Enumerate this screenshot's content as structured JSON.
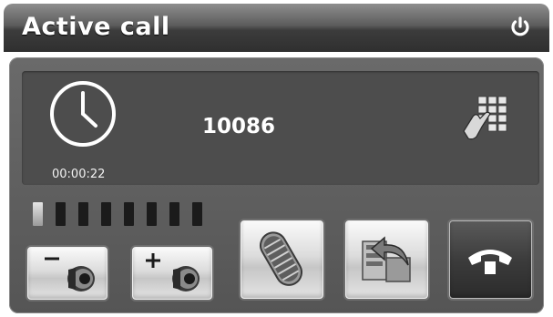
{
  "title": "Active call",
  "call": {
    "number": "10086",
    "duration": "00:00:22"
  },
  "volume": {
    "level": 1,
    "max": 8
  },
  "icons": {
    "power": "power-icon",
    "clock": "clock-icon",
    "keypad": "dialpad-icon",
    "volume_down": "volume-down-icon",
    "volume_up": "volume-up-icon",
    "microphone": "microphone-icon",
    "transfer": "transfer-icon",
    "hangup": "hangup-icon"
  },
  "colors": {
    "panel": "#555555",
    "display": "#4d4d4d",
    "text": "#ffffff"
  }
}
